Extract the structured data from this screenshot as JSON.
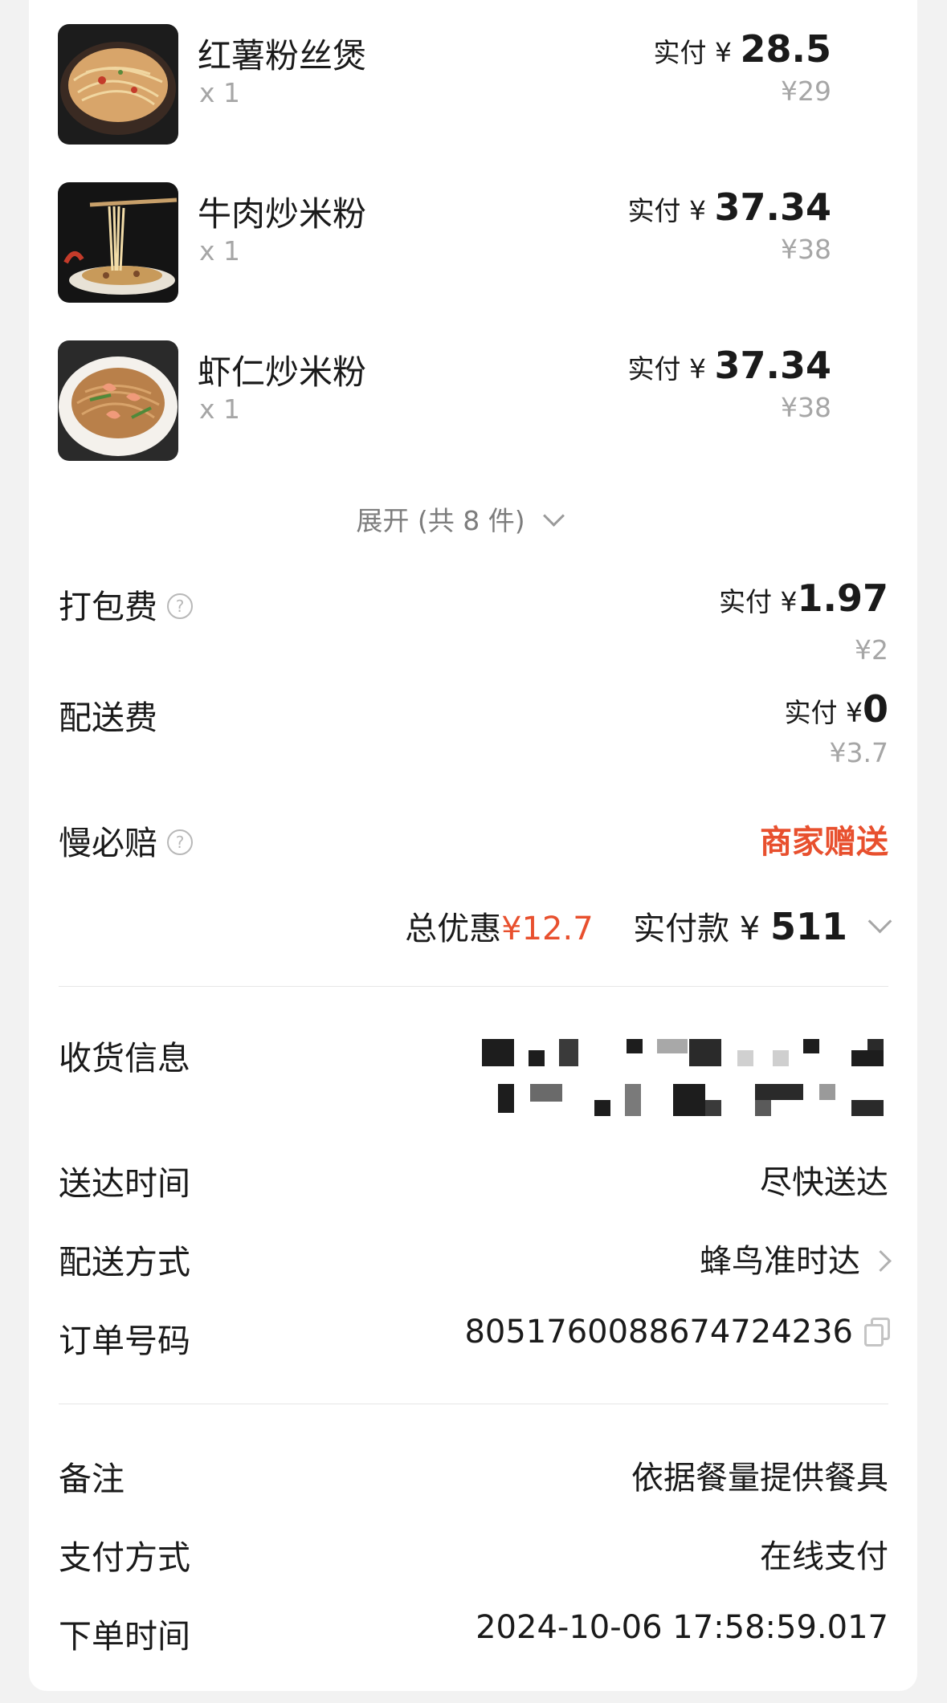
{
  "items": [
    {
      "name": "红薯粉丝煲",
      "qty": "x 1",
      "paid_prefix": "实付 ¥ ",
      "paid_amount": "28.5",
      "original": "¥29",
      "image": "sweet-potato-noodle-pot"
    },
    {
      "name": "牛肉炒米粉",
      "qty": "x 1",
      "paid_prefix": "实付 ¥ ",
      "paid_amount": "37.34",
      "original": "¥38",
      "image": "beef-fried-rice-noodles"
    },
    {
      "name": "虾仁炒米粉",
      "qty": "x 1",
      "paid_prefix": "实付 ¥ ",
      "paid_amount": "37.34",
      "original": "¥38",
      "image": "shrimp-fried-rice-noodles"
    }
  ],
  "expand_label": "展开 (共 8 件)",
  "fees": {
    "packing": {
      "label": "打包费",
      "paid_prefix": "实付 ¥",
      "paid_amount": "1.97",
      "original": "¥2"
    },
    "delivery": {
      "label": "配送费",
      "paid_prefix": "实付 ¥",
      "paid_amount": "0",
      "original": "¥3.7"
    },
    "late_comp": {
      "label": "慢必赔",
      "value": "商家赠送"
    }
  },
  "summary": {
    "discount_label": "总优惠",
    "discount_amount": "¥12.7",
    "paid_label": "实付款 ¥ ",
    "paid_amount": "511"
  },
  "info": {
    "receiver": {
      "label": "收货信息"
    },
    "delivery_time": {
      "label": "送达时间",
      "value": "尽快送达"
    },
    "delivery_method": {
      "label": "配送方式",
      "value": "蜂鸟准时达"
    },
    "order_number": {
      "label": "订单号码",
      "value": "8051760088674724236"
    },
    "remark": {
      "label": "备注",
      "value": "依据餐量提供餐具"
    },
    "payment": {
      "label": "支付方式",
      "value": "在线支付"
    },
    "order_time": {
      "label": "下单时间",
      "value": "2024-10-06 17:58:59.017"
    }
  },
  "icons": {
    "help": "?",
    "expand": "chevron-down-icon",
    "arrow": "chevron-right-icon",
    "copy": "copy-icon"
  },
  "colors": {
    "accent_red": "#e8502e",
    "muted": "#a6a6a6"
  }
}
